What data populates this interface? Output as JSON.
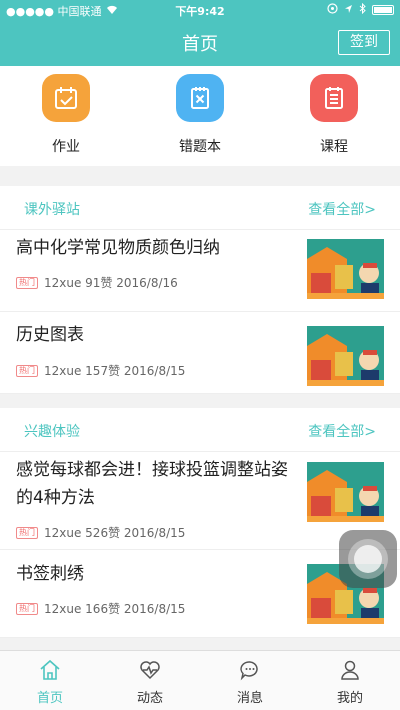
{
  "status_bar": {
    "carrier": "●●●●● 中国联通",
    "time": "下午9:42"
  },
  "header": {
    "title": "首页",
    "checkin_label": "签到"
  },
  "shortcuts": [
    {
      "label": "作业",
      "icon": "calendar-check-icon",
      "color": "#f5a33b"
    },
    {
      "label": "错题本",
      "icon": "notebook-x-icon",
      "color": "#4fb3f2"
    },
    {
      "label": "课程",
      "icon": "list-document-icon",
      "color": "#f2605b"
    }
  ],
  "sections": [
    {
      "title": "课外驿站",
      "more_label": "查看全部>",
      "articles": [
        {
          "title": "高中化学常见物质颜色归纳",
          "tag": "热门",
          "meta": "12xue 91赞 2016/8/16"
        },
        {
          "title": "历史图表",
          "tag": "热门",
          "meta": "12xue 157赞 2016/8/15"
        }
      ]
    },
    {
      "title": "兴趣体验",
      "more_label": "查看全部>",
      "articles": [
        {
          "title": "感觉每球都会进！接球投篮调整站姿的4种方法",
          "tag": "热门",
          "meta": "12xue 526赞 2016/8/15"
        },
        {
          "title": "书签刺绣",
          "tag": "热门",
          "meta": "12xue 166赞 2016/8/15"
        }
      ]
    }
  ],
  "tabbar": [
    {
      "label": "首页",
      "icon": "home-icon",
      "active": true
    },
    {
      "label": "动态",
      "icon": "heartbeat-icon",
      "active": false
    },
    {
      "label": "消息",
      "icon": "chat-bubble-icon",
      "active": false
    },
    {
      "label": "我的",
      "icon": "person-icon",
      "active": false
    }
  ],
  "colors": {
    "brand": "#4dc5c0",
    "hot_tag": "#f06a6a"
  }
}
